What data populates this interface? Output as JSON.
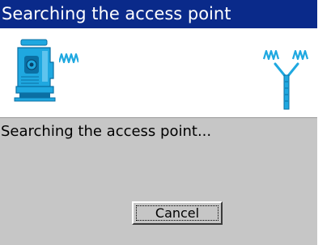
{
  "window": {
    "title": "Searching the access point"
  },
  "banner": {
    "device_icon": "total-station-instrument-icon",
    "device_signal_icon": "wireless-signal-waves-icon",
    "access_point_icon": "wireless-access-point-antenna-icon",
    "icon_color": "#1fa8e0"
  },
  "content": {
    "message": "Searching the access point..."
  },
  "buttons": {
    "cancel_label": "Cancel"
  },
  "colors": {
    "titlebar_bg": "#0a2a8a",
    "titlebar_text": "#ffffff",
    "content_bg": "#c6c6c6"
  }
}
